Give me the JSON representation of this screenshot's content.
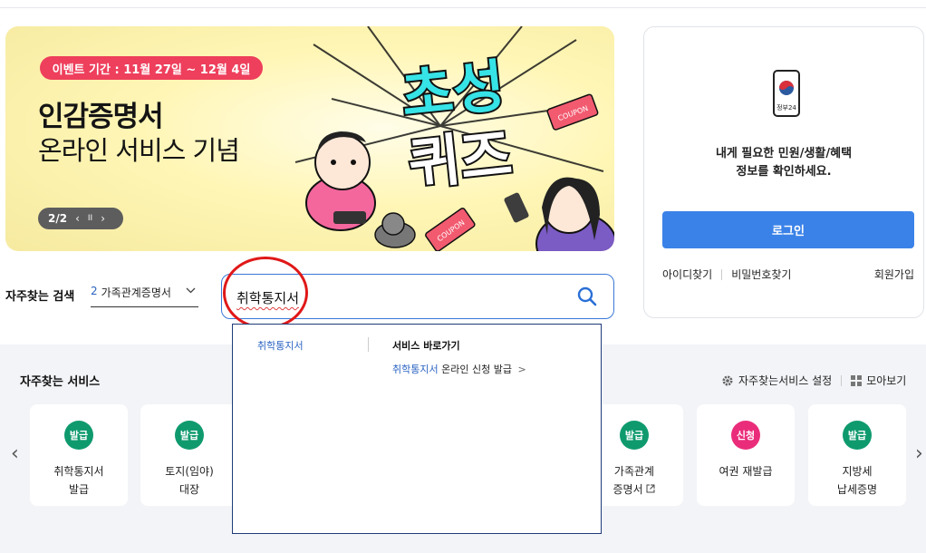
{
  "banner": {
    "event_period": "이벤트 기간 : 11월 27일 ~ 12월 4일",
    "title": "인감증명서",
    "subtitle": "온라인 서비스 기념",
    "slide_counter": "2/2",
    "prev_label": "‹",
    "pause_label": "II",
    "next_label": "›",
    "quiz_line1": "초성",
    "quiz_line2": "퀴즈",
    "coupon": "COUPON"
  },
  "login": {
    "app_label": "정부24",
    "message_line1": "내게 필요한 민원/생활/혜택",
    "message_line2": "정보를 확인하세요.",
    "login_button": "로그인",
    "find_id": "아이디찾기",
    "find_password": "비밀번호찾기",
    "signup": "회원가입"
  },
  "search": {
    "fav_label": "자주찾는 검색",
    "fav_select_num": "2",
    "fav_select_text": "가족관계증명서",
    "query": "취학통지서"
  },
  "autocomplete": {
    "suggestion": "취학통지서",
    "shortcut_heading": "서비스 바로가기",
    "shortcut_highlight": "취학통지서",
    "shortcut_rest": "온라인 신청 발급",
    "shortcut_arrow": ">"
  },
  "services": {
    "title": "자주찾는 서비스",
    "settings_label": "자주찾는서비스 설정",
    "view_all_label": "모아보기",
    "cards": [
      {
        "badge": "발급",
        "line1": "취학통지서",
        "line2": "발급",
        "badge_color": "#0f9a6e"
      },
      {
        "badge": "발급",
        "line1": "토지(임야)",
        "line2": "대장",
        "badge_color": "#0f9a6e"
      },
      {
        "badge": "발급",
        "line1": "가족관계",
        "line2": "증명서",
        "badge_color": "#0f9a6e"
      },
      {
        "badge": "신청",
        "line1": "여권 재발급",
        "line2": "",
        "badge_color": "#ea2d7b"
      },
      {
        "badge": "발급",
        "line1": "지방세",
        "line2": "납세증명",
        "badge_color": "#0f9a6e"
      }
    ]
  },
  "colors": {
    "primary_blue": "#3b82e8",
    "event_red": "#ee3f5c",
    "badge_green": "#0f9a6e",
    "badge_pink": "#ea2d7b"
  }
}
